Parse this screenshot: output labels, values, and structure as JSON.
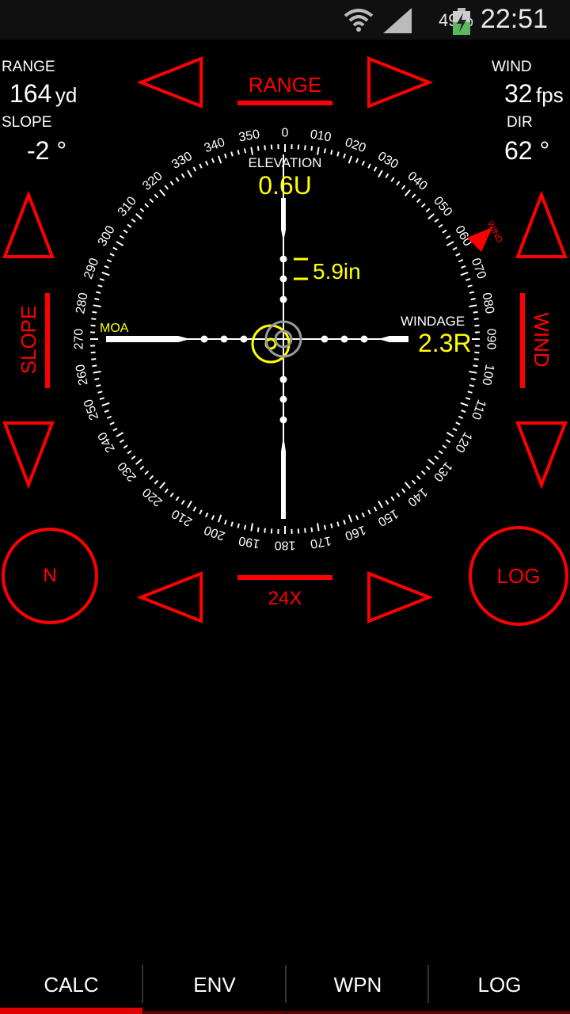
{
  "status_bar": {
    "battery_percent": "49%",
    "time": "22:51",
    "icons": [
      "wifi-icon",
      "signal-icon",
      "battery-charging-icon"
    ]
  },
  "readouts": {
    "range_label": "RANGE",
    "range_value": "164",
    "range_unit": "yd",
    "slope_label": "SLOPE",
    "slope_value": "-2 °",
    "wind_label": "WIND",
    "wind_value": "32",
    "wind_unit": "fps",
    "dir_label": "DIR",
    "dir_value": "62 °"
  },
  "controls": {
    "range_label": "RANGE",
    "slope_label": "SLOPE",
    "wind_label": "WIND",
    "zoom_label": "24X",
    "north_button": "N",
    "log_button": "LOG"
  },
  "reticle": {
    "elevation_label": "ELEVATION",
    "elevation_value": "0.6U",
    "windage_label": "WINDAGE",
    "windage_value": "2.3R",
    "moa_label": "MOA",
    "group_size": "5.9in",
    "wind_marker_label": "WIND",
    "compass_labels": [
      "0",
      "010",
      "020",
      "030",
      "040",
      "050",
      "060",
      "070",
      "080",
      "090",
      "100",
      "110",
      "120",
      "130",
      "140",
      "150",
      "160",
      "170",
      "180",
      "190",
      "200",
      "210",
      "220",
      "230",
      "240",
      "250",
      "260",
      "270",
      "280",
      "290",
      "300",
      "310",
      "320",
      "330",
      "340",
      "350"
    ]
  },
  "colors": {
    "accent": "#ff0000",
    "reticle_highlight": "#ffff00",
    "background": "#000000"
  },
  "tabs": [
    {
      "label": "CALC",
      "active": true
    },
    {
      "label": "ENV",
      "active": false
    },
    {
      "label": "WPN",
      "active": false
    },
    {
      "label": "LOG",
      "active": false
    }
  ]
}
